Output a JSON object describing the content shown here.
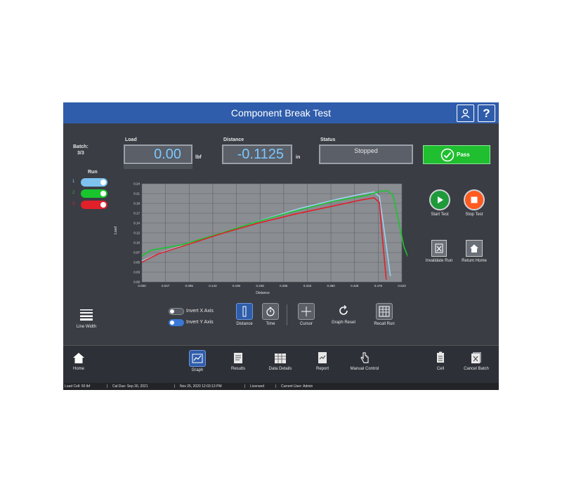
{
  "app": {
    "title": "Component Break Test"
  },
  "batch": {
    "label": "Batch:",
    "value": "3/3"
  },
  "load": {
    "label": "Load",
    "value": "0.00",
    "unit": "lbf"
  },
  "distance": {
    "label": "Distance",
    "value": "-0.1125",
    "unit": "in"
  },
  "status": {
    "label": "Status",
    "value": "Stopped"
  },
  "result": {
    "label": "Pass"
  },
  "runs": {
    "label": "Run",
    "items": [
      {
        "num": "1",
        "color": "#7ec3f0"
      },
      {
        "num": "2",
        "color": "#19c52d"
      },
      {
        "num": "3",
        "color": "#e0202a"
      }
    ]
  },
  "side_buttons": {
    "start": "Start Test",
    "stop": "Stop Test",
    "invalidate": "Invalidate Run",
    "return_home": "Return Home"
  },
  "axis_options": {
    "invert_x": "Invert X Axis",
    "invert_y": "Invert Y Axis"
  },
  "tools": {
    "line_width": "Line Width",
    "distance": "Distance",
    "time": "Time",
    "cursor": "Cursor",
    "graph_reset": "Graph Reset",
    "recall_run": "Recall Run"
  },
  "nav": {
    "home": "Home",
    "graph": "Graph",
    "results": "Results",
    "data_details": "Data Details",
    "report": "Report",
    "manual_control": "Manual Control",
    "cell": "Cell",
    "cancel_batch": "Cancel Batch"
  },
  "statusbar": {
    "load_cell": "Load Cell: 50 lbf",
    "cal_due": "Cal Due: Sep 30, 2021",
    "datetime": "Nov 25, 2020 12:03:13 PM",
    "license": "Licensed",
    "user": "Current User: Admin"
  },
  "colors": {
    "titlebar": "#2f5dab",
    "pass": "#1fbf2f",
    "start": "#1f9a3a",
    "stop": "#ff5a1f"
  },
  "chart_data": {
    "type": "line",
    "xlabel": "Distance",
    "ylabel": "Load",
    "xlim": [
      0.0,
      0.952
    ],
    "ylim": [
      0.0,
      0.84
    ],
    "x_ticks": [
      "0.000",
      "0.047",
      "0.095",
      "0.143",
      "0.190",
      "0.238",
      "0.285",
      "0.333",
      "0.380",
      "0.428",
      "0.476",
      "0.523"
    ],
    "y_ticks": [
      "0.00",
      "0.03",
      "0.05",
      "0.07",
      "0.10",
      "0.12",
      "0.14",
      "0.17",
      "0.19",
      "0.21",
      "0.24"
    ],
    "series": [
      {
        "color": "#9fd2ef",
        "points": [
          [
            0.0,
            0.18
          ],
          [
            0.08,
            0.26
          ],
          [
            0.2,
            0.35
          ],
          [
            0.32,
            0.44
          ],
          [
            0.44,
            0.53
          ],
          [
            0.58,
            0.63
          ],
          [
            0.72,
            0.71
          ],
          [
            0.8,
            0.75
          ],
          [
            0.85,
            0.77
          ],
          [
            0.87,
            0.73
          ],
          [
            0.89,
            0.4
          ],
          [
            0.91,
            0.05
          ]
        ]
      },
      {
        "color": "#19c52d",
        "points": [
          [
            0.0,
            0.22
          ],
          [
            0.03,
            0.27
          ],
          [
            0.15,
            0.32
          ],
          [
            0.28,
            0.41
          ],
          [
            0.4,
            0.5
          ],
          [
            0.55,
            0.6
          ],
          [
            0.7,
            0.69
          ],
          [
            0.82,
            0.74
          ],
          [
            0.88,
            0.78
          ],
          [
            0.9,
            0.78
          ],
          [
            0.92,
            0.74
          ],
          [
            0.96,
            0.3
          ],
          [
            0.99,
            0.12
          ]
        ]
      },
      {
        "color": "#e0202a",
        "points": [
          [
            0.0,
            0.17
          ],
          [
            0.06,
            0.24
          ],
          [
            0.18,
            0.33
          ],
          [
            0.3,
            0.42
          ],
          [
            0.42,
            0.5
          ],
          [
            0.56,
            0.58
          ],
          [
            0.7,
            0.65
          ],
          [
            0.8,
            0.7
          ],
          [
            0.85,
            0.72
          ],
          [
            0.87,
            0.68
          ],
          [
            0.88,
            0.4
          ],
          [
            0.895,
            0.02
          ]
        ]
      }
    ]
  }
}
